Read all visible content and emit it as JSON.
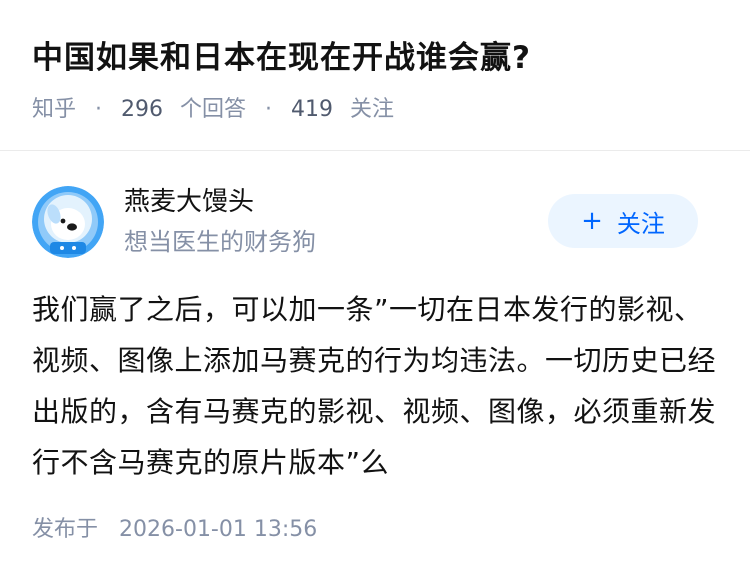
{
  "question": {
    "title": "中国如果和日本在现在开战谁会赢?",
    "source": "知乎",
    "answers_count": "296",
    "answers_label": "个回答",
    "followers_count": "419",
    "followers_label": "关注",
    "separator": "·"
  },
  "author": {
    "name": "燕麦大馒头",
    "bio": "想当医生的财务狗",
    "follow_label": "关注",
    "follow_icon": "+",
    "avatar_icon": "dog-astronaut-avatar"
  },
  "answer": {
    "content": "我们赢了之后，可以加一条”一切在日本发行的影视、视频、图像上添加马赛克的行为均违法。一切历史已经出版的，含有马赛克的影视、视频、图像，必须重新发行不含马赛克的原片版本”么",
    "published_label": "发布于",
    "published_time": "2026-01-01 13:56"
  },
  "colors": {
    "accent": "#0066ff",
    "follow_bg": "#ebf5ff",
    "muted": "#8590a6",
    "text": "#121212",
    "avatar_bg": "#42a5f5"
  }
}
